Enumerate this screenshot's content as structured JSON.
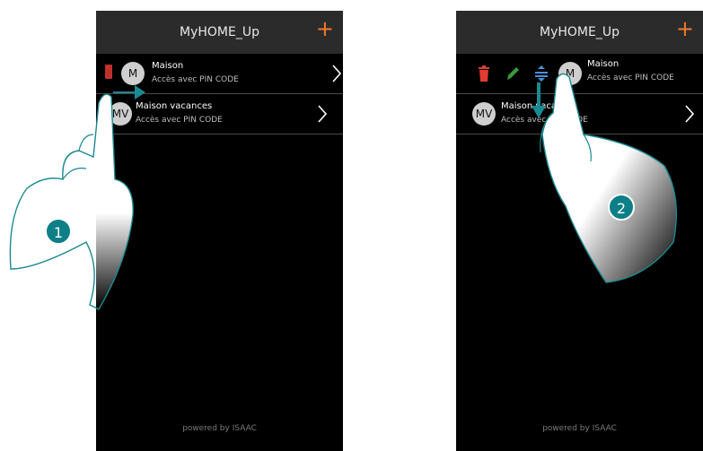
{
  "left_screen": {
    "header": {
      "title": "MyHOME_Up",
      "add_icon": "plus-icon"
    },
    "items": [
      {
        "avatar": "M",
        "name": "Maison",
        "subtitle": "Accès avec PIN CODE"
      },
      {
        "avatar": "MV",
        "name": "Maison vacances",
        "subtitle": "Accès avec PIN CODE"
      }
    ],
    "footer": "powered by ISAAC",
    "gesture": {
      "step": "1",
      "direction": "swipe-right"
    }
  },
  "right_screen": {
    "header": {
      "title": "MyHOME_Up",
      "add_icon": "plus-icon"
    },
    "items": [
      {
        "avatar": "M",
        "name": "Maison",
        "subtitle": "Accès avec PIN CODE",
        "actions": [
          "trash-icon",
          "pencil-icon",
          "reorder-icon"
        ]
      },
      {
        "avatar": "MV",
        "name": "Maison vacances",
        "subtitle": "Accès avec PIN CODE"
      }
    ],
    "footer": "powered by ISAAC",
    "gesture": {
      "step": "2",
      "direction": "drag-down"
    }
  },
  "colors": {
    "accent_orange": "#f2792a",
    "step_teal": "#0d7f87",
    "delete_red": "#e03c31",
    "edit_green": "#3c9a3c",
    "reorder_blue": "#4a90d9"
  }
}
